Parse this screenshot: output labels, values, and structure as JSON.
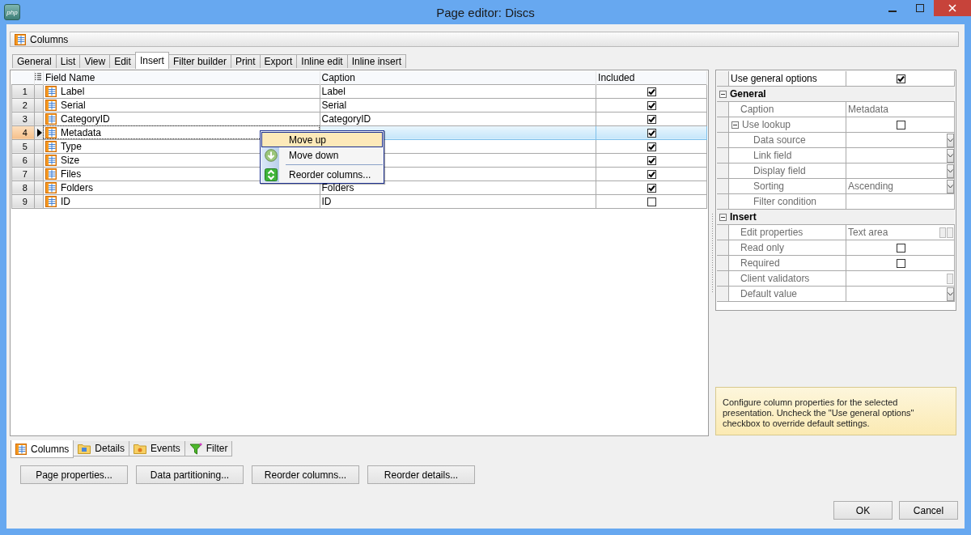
{
  "window": {
    "title": "Page editor: Discs",
    "logo_text": "php"
  },
  "columns_bar": {
    "label": "Columns"
  },
  "tabs": [
    {
      "label": "General",
      "selected": false
    },
    {
      "label": "List",
      "selected": false
    },
    {
      "label": "View",
      "selected": false
    },
    {
      "label": "Edit",
      "selected": false
    },
    {
      "label": "Insert",
      "selected": true
    },
    {
      "label": "Filter builder",
      "selected": false
    },
    {
      "label": "Print",
      "selected": false
    },
    {
      "label": "Export",
      "selected": false
    },
    {
      "label": "Inline edit",
      "selected": false
    },
    {
      "label": "Inline insert",
      "selected": false
    }
  ],
  "grid": {
    "columns": [
      "Field Name",
      "Caption",
      "Included"
    ],
    "rows": [
      {
        "number": "1",
        "field_name": "Label",
        "caption": "Label",
        "included": true,
        "selected": false
      },
      {
        "number": "2",
        "field_name": "Serial",
        "caption": "Serial",
        "included": true,
        "selected": false
      },
      {
        "number": "3",
        "field_name": "CategoryID",
        "caption": "CategoryID",
        "included": true,
        "selected": false
      },
      {
        "number": "4",
        "field_name": "Metadata",
        "included": true,
        "selected": true
      },
      {
        "number": "5",
        "field_name": "Type",
        "included": true,
        "selected": false
      },
      {
        "number": "6",
        "field_name": "Size",
        "included": true,
        "selected": false
      },
      {
        "number": "7",
        "field_name": "Files",
        "included": true,
        "selected": false
      },
      {
        "number": "8",
        "field_name": "Folders",
        "caption": "Folders",
        "included": true,
        "selected": false
      },
      {
        "number": "9",
        "field_name": "ID",
        "caption": "ID",
        "included": false,
        "selected": false
      }
    ]
  },
  "context_menu": {
    "items": [
      {
        "kind": "plain",
        "label": "Move up",
        "selected": true
      },
      {
        "kind": "down",
        "label": "Move down",
        "selected": false
      },
      {
        "kind": "separator"
      },
      {
        "kind": "reorder",
        "label": "Reorder columns...",
        "selected": false
      }
    ]
  },
  "properties": {
    "top": {
      "label": "Use general options",
      "checked": true
    },
    "sections": [
      {
        "title": "General",
        "expanded": true,
        "rows": [
          {
            "label": "Caption",
            "kind": "text",
            "value": "Metadata"
          },
          {
            "label": "Use lookup",
            "kind": "check",
            "checked": false,
            "expanded": true,
            "children": [
              {
                "label": "Data source",
                "kind": "dropdown"
              },
              {
                "label": "Link field",
                "kind": "dropdown"
              },
              {
                "label": "Display field",
                "kind": "dropdown"
              },
              {
                "label": "Sorting",
                "kind": "dropdown",
                "value": "Ascending"
              },
              {
                "label": "Filter condition",
                "kind": "text"
              }
            ]
          }
        ]
      },
      {
        "title": "Insert",
        "expanded": true,
        "rows": [
          {
            "label": "Edit properties",
            "kind": "buttons",
            "value": "Text area"
          },
          {
            "label": "Read only",
            "kind": "check",
            "checked": false
          },
          {
            "label": "Required",
            "kind": "check",
            "checked": false
          },
          {
            "label": "Client validators",
            "kind": "button"
          },
          {
            "label": "Default value",
            "kind": "dropdown"
          }
        ]
      }
    ]
  },
  "info": "Configure column properties for the selected presentation. Uncheck the \"Use general options\" checkbox to override default settings.",
  "bottom_tabs": [
    {
      "label": "Columns",
      "selected": true
    },
    {
      "label": "Details",
      "selected": false
    },
    {
      "label": "Events",
      "selected": false
    },
    {
      "label": "Filter",
      "selected": false
    }
  ],
  "actions": [
    "Page properties...",
    "Data partitioning...",
    "Reorder columns...",
    "Reorder details..."
  ],
  "dialog_buttons": [
    "OK",
    "Cancel"
  ]
}
